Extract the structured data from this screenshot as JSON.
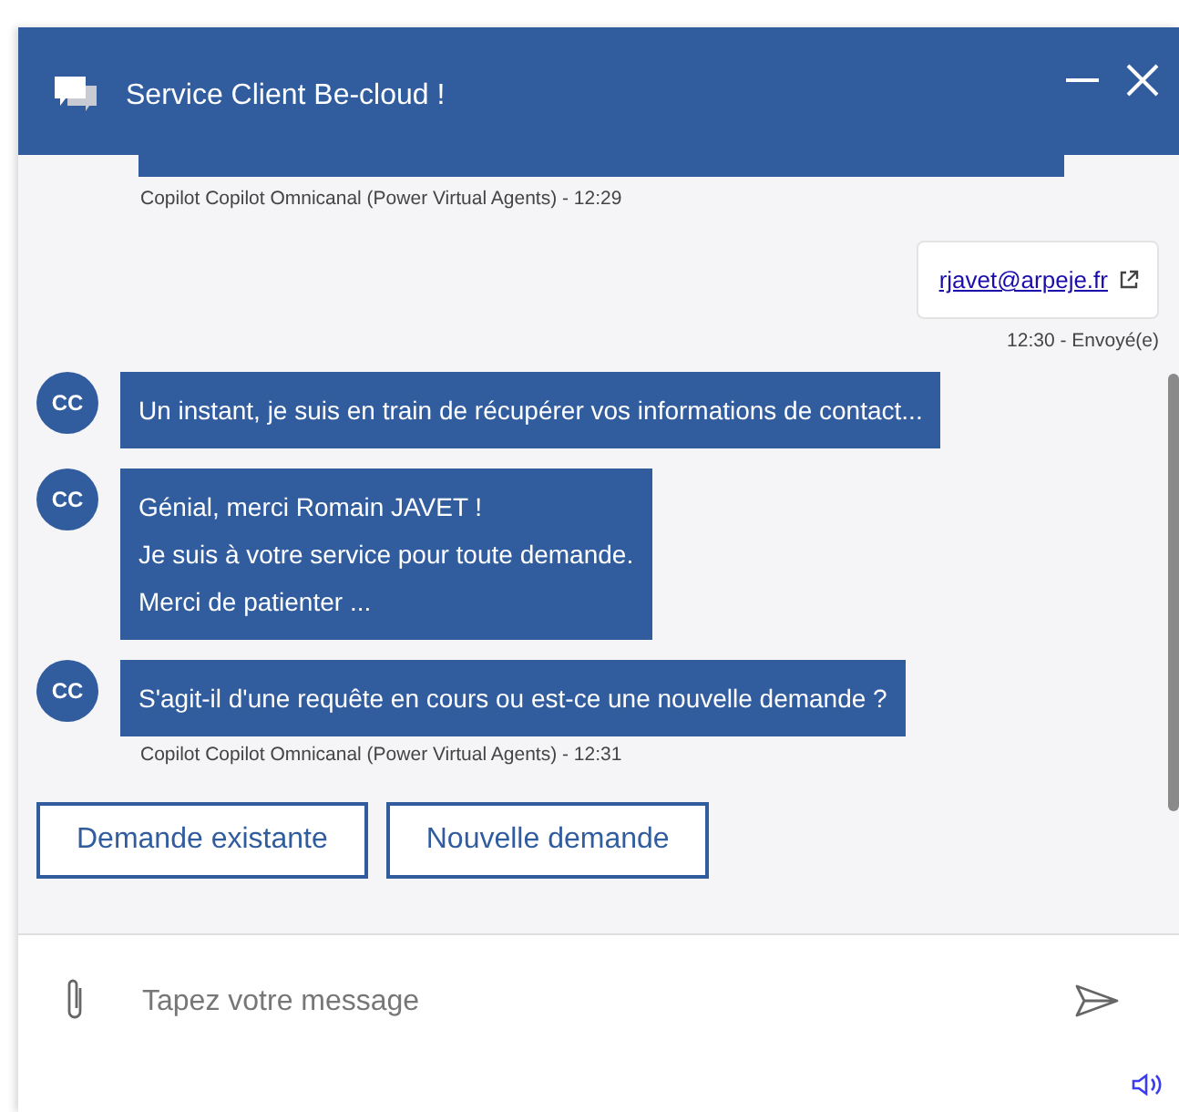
{
  "header": {
    "title": "Service Client Be-cloud !"
  },
  "earlier_message": {
    "meta": "Copilot Copilot Omnicanal (Power Virtual Agents) - 12:29"
  },
  "user_message": {
    "link": "rjavet@arpeje.fr",
    "status": "12:30 - Envoyé(e)"
  },
  "bot_messages": [
    {
      "avatar": "CC",
      "paragraphs": [
        "Un instant, je suis en train de récupérer vos informations de contact..."
      ]
    },
    {
      "avatar": "CC",
      "paragraphs": [
        "Génial, merci Romain JAVET !",
        "Je suis à votre service pour toute demande.",
        "Merci de patienter ..."
      ]
    },
    {
      "avatar": "CC",
      "paragraphs": [
        "S'agit-il d'une requête en cours ou est-ce une nouvelle demande ?"
      ]
    }
  ],
  "last_meta": "Copilot Copilot Omnicanal (Power Virtual Agents) - 12:31",
  "suggested_actions": [
    "Demande existante",
    "Nouvelle demande"
  ],
  "composer": {
    "placeholder": "Tapez votre message"
  }
}
